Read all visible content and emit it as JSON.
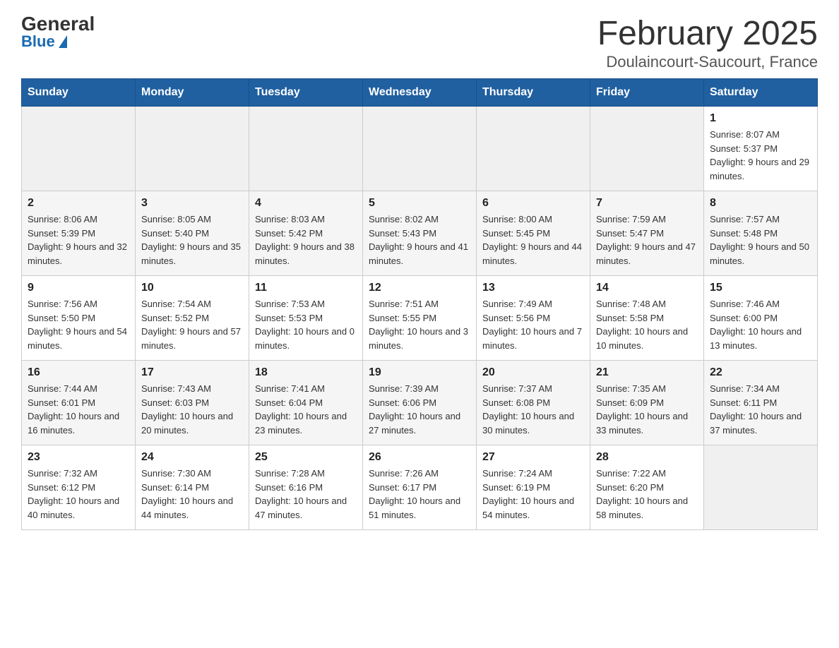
{
  "header": {
    "logo_general": "General",
    "logo_blue": "Blue",
    "month_title": "February 2025",
    "location": "Doulaincourt-Saucourt, France"
  },
  "weekdays": [
    "Sunday",
    "Monday",
    "Tuesday",
    "Wednesday",
    "Thursday",
    "Friday",
    "Saturday"
  ],
  "weeks": [
    [
      {
        "day": "",
        "info": ""
      },
      {
        "day": "",
        "info": ""
      },
      {
        "day": "",
        "info": ""
      },
      {
        "day": "",
        "info": ""
      },
      {
        "day": "",
        "info": ""
      },
      {
        "day": "",
        "info": ""
      },
      {
        "day": "1",
        "info": "Sunrise: 8:07 AM\nSunset: 5:37 PM\nDaylight: 9 hours and 29 minutes."
      }
    ],
    [
      {
        "day": "2",
        "info": "Sunrise: 8:06 AM\nSunset: 5:39 PM\nDaylight: 9 hours and 32 minutes."
      },
      {
        "day": "3",
        "info": "Sunrise: 8:05 AM\nSunset: 5:40 PM\nDaylight: 9 hours and 35 minutes."
      },
      {
        "day": "4",
        "info": "Sunrise: 8:03 AM\nSunset: 5:42 PM\nDaylight: 9 hours and 38 minutes."
      },
      {
        "day": "5",
        "info": "Sunrise: 8:02 AM\nSunset: 5:43 PM\nDaylight: 9 hours and 41 minutes."
      },
      {
        "day": "6",
        "info": "Sunrise: 8:00 AM\nSunset: 5:45 PM\nDaylight: 9 hours and 44 minutes."
      },
      {
        "day": "7",
        "info": "Sunrise: 7:59 AM\nSunset: 5:47 PM\nDaylight: 9 hours and 47 minutes."
      },
      {
        "day": "8",
        "info": "Sunrise: 7:57 AM\nSunset: 5:48 PM\nDaylight: 9 hours and 50 minutes."
      }
    ],
    [
      {
        "day": "9",
        "info": "Sunrise: 7:56 AM\nSunset: 5:50 PM\nDaylight: 9 hours and 54 minutes."
      },
      {
        "day": "10",
        "info": "Sunrise: 7:54 AM\nSunset: 5:52 PM\nDaylight: 9 hours and 57 minutes."
      },
      {
        "day": "11",
        "info": "Sunrise: 7:53 AM\nSunset: 5:53 PM\nDaylight: 10 hours and 0 minutes."
      },
      {
        "day": "12",
        "info": "Sunrise: 7:51 AM\nSunset: 5:55 PM\nDaylight: 10 hours and 3 minutes."
      },
      {
        "day": "13",
        "info": "Sunrise: 7:49 AM\nSunset: 5:56 PM\nDaylight: 10 hours and 7 minutes."
      },
      {
        "day": "14",
        "info": "Sunrise: 7:48 AM\nSunset: 5:58 PM\nDaylight: 10 hours and 10 minutes."
      },
      {
        "day": "15",
        "info": "Sunrise: 7:46 AM\nSunset: 6:00 PM\nDaylight: 10 hours and 13 minutes."
      }
    ],
    [
      {
        "day": "16",
        "info": "Sunrise: 7:44 AM\nSunset: 6:01 PM\nDaylight: 10 hours and 16 minutes."
      },
      {
        "day": "17",
        "info": "Sunrise: 7:43 AM\nSunset: 6:03 PM\nDaylight: 10 hours and 20 minutes."
      },
      {
        "day": "18",
        "info": "Sunrise: 7:41 AM\nSunset: 6:04 PM\nDaylight: 10 hours and 23 minutes."
      },
      {
        "day": "19",
        "info": "Sunrise: 7:39 AM\nSunset: 6:06 PM\nDaylight: 10 hours and 27 minutes."
      },
      {
        "day": "20",
        "info": "Sunrise: 7:37 AM\nSunset: 6:08 PM\nDaylight: 10 hours and 30 minutes."
      },
      {
        "day": "21",
        "info": "Sunrise: 7:35 AM\nSunset: 6:09 PM\nDaylight: 10 hours and 33 minutes."
      },
      {
        "day": "22",
        "info": "Sunrise: 7:34 AM\nSunset: 6:11 PM\nDaylight: 10 hours and 37 minutes."
      }
    ],
    [
      {
        "day": "23",
        "info": "Sunrise: 7:32 AM\nSunset: 6:12 PM\nDaylight: 10 hours and 40 minutes."
      },
      {
        "day": "24",
        "info": "Sunrise: 7:30 AM\nSunset: 6:14 PM\nDaylight: 10 hours and 44 minutes."
      },
      {
        "day": "25",
        "info": "Sunrise: 7:28 AM\nSunset: 6:16 PM\nDaylight: 10 hours and 47 minutes."
      },
      {
        "day": "26",
        "info": "Sunrise: 7:26 AM\nSunset: 6:17 PM\nDaylight: 10 hours and 51 minutes."
      },
      {
        "day": "27",
        "info": "Sunrise: 7:24 AM\nSunset: 6:19 PM\nDaylight: 10 hours and 54 minutes."
      },
      {
        "day": "28",
        "info": "Sunrise: 7:22 AM\nSunset: 6:20 PM\nDaylight: 10 hours and 58 minutes."
      },
      {
        "day": "",
        "info": ""
      }
    ]
  ]
}
